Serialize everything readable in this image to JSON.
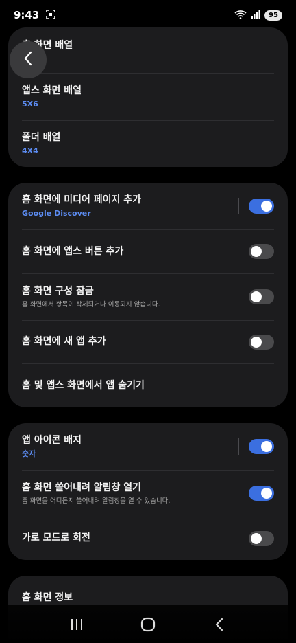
{
  "status_bar": {
    "time": "9:43",
    "battery": "95"
  },
  "card1": {
    "rows": [
      {
        "title": "홈 화면 배열"
      },
      {
        "title": "앱스 화면 배열",
        "sub": "5X6"
      },
      {
        "title": "폴더 배열",
        "sub": "4X4"
      }
    ]
  },
  "card2": {
    "rows": [
      {
        "title": "홈 화면에 미디어 페이지 추가",
        "sub": "Google Discover",
        "toggle": "on"
      },
      {
        "title": "홈 화면에 앱스 버튼 추가",
        "toggle": "off"
      },
      {
        "title": "홈 화면 구성 잠금",
        "desc": "홈 화면에서 항목이 삭제되거나 이동되지 않습니다.",
        "toggle": "off"
      },
      {
        "title": "홈 화면에 새 앱 추가",
        "toggle": "off"
      },
      {
        "title": "홈 및 앱스 화면에서 앱 숨기기"
      }
    ]
  },
  "card3": {
    "rows": [
      {
        "title": "앱 아이콘 배지",
        "sub": "숫자",
        "toggle": "on"
      },
      {
        "title": "홈 화면 쓸어내려 알림창 열기",
        "desc": "홈 화면을 어디든지 쓸어내려 알림창을 열 수 있습니다.",
        "toggle": "on"
      },
      {
        "title": "가로 모드로 회전",
        "toggle": "off"
      }
    ]
  },
  "card4": {
    "rows": [
      {
        "title": "홈 화면 정보"
      }
    ]
  },
  "icons": {
    "back": "chevron-left-icon",
    "recents": "recent-apps-icon",
    "home": "home-icon",
    "nav_back": "back-icon",
    "wifi": "wifi-icon",
    "signal": "signal-icon",
    "screenshot": "screenshot-icon"
  },
  "colors": {
    "accent": "#3b6fe0",
    "subtitle_blue": "#5c8cf2",
    "card_bg": "#1c1c1e"
  }
}
